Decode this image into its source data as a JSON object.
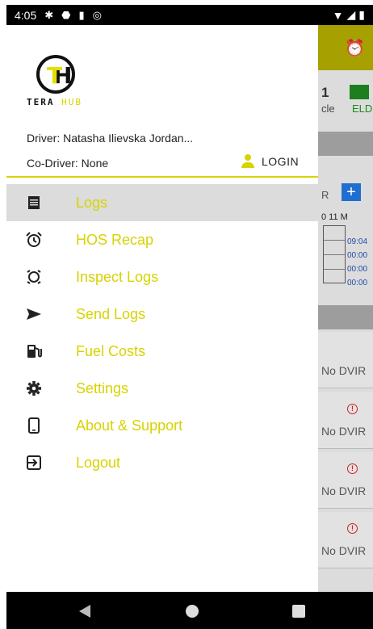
{
  "status_bar": {
    "time": "4:05",
    "icons": [
      "gear-icon",
      "shield-icon",
      "sd-card-icon",
      "sync-icon"
    ],
    "right_icons": [
      "wifi-icon",
      "signal-icon",
      "battery-icon"
    ]
  },
  "background": {
    "counter": "1",
    "vehicle_fragment": "cle",
    "eld_label": "ELD",
    "r_fragment": "R",
    "month_fragment": "0 11 M",
    "times": [
      "09:04",
      "00:00",
      "00:00",
      "00:00"
    ],
    "dvir_label": "No DVIR"
  },
  "drawer": {
    "logo": {
      "brand_a": "TERA",
      "brand_b": "HUB"
    },
    "driver_text": "Driver: Natasha Ilievska Jordan...",
    "codriver_text": "Co-Driver: None",
    "login_label": "LOGIN",
    "menu": [
      {
        "label": "Logs",
        "icon": "logs-icon",
        "active": true
      },
      {
        "label": "HOS Recap",
        "icon": "alarm-clock-icon"
      },
      {
        "label": "Inspect Logs",
        "icon": "inspect-icon"
      },
      {
        "label": "Send Logs",
        "icon": "send-icon"
      },
      {
        "label": "Fuel Costs",
        "icon": "fuel-pump-icon"
      },
      {
        "label": "Settings",
        "icon": "gear-icon"
      },
      {
        "label": "About & Support",
        "icon": "phone-icon"
      },
      {
        "label": "Logout",
        "icon": "logout-icon"
      }
    ]
  },
  "colors": {
    "accent": "#d7d300",
    "appbar": "#a6a000",
    "active_row": "#dcdcdc"
  }
}
